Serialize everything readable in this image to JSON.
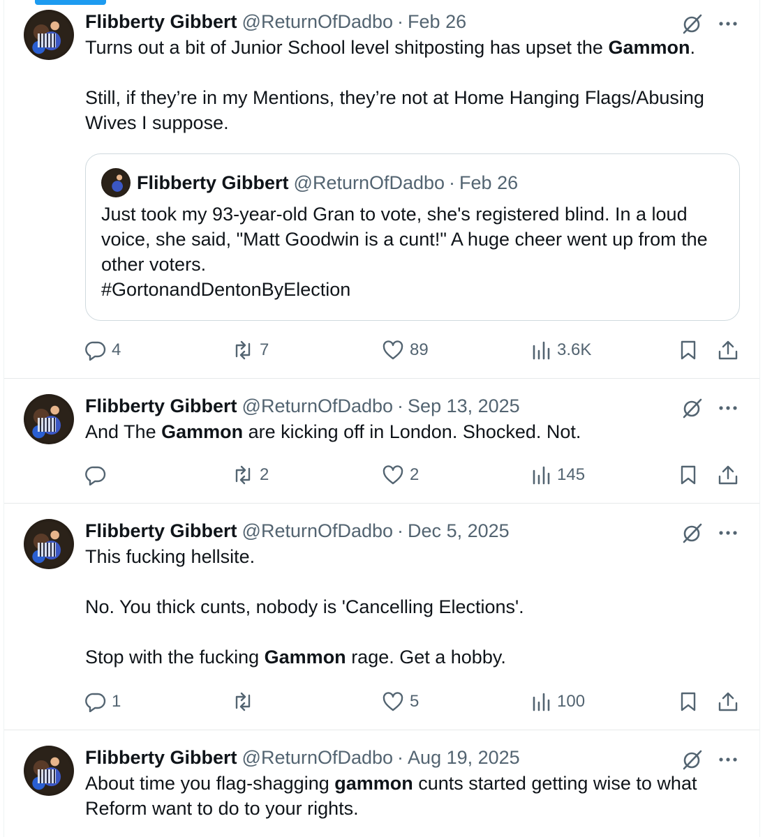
{
  "author": {
    "name": "Flibberty Gibbert",
    "handle": "@ReturnOfDadbo",
    "separator": "·"
  },
  "tweets": [
    {
      "date": "Feb 26",
      "text_parts": [
        {
          "t": "Turns out a bit of Junior School level shitposting has upset the "
        },
        {
          "t": "Gammon",
          "bold": true
        },
        {
          "t": ".\n\nStill, if they’re in my Mentions, they’re not at Home Hanging Flags/Abusing Wives I suppose."
        }
      ],
      "quote": {
        "name": "Flibberty Gibbert",
        "handle": "@ReturnOfDadbo",
        "date": "Feb 26",
        "text": "Just took my 93-year-old Gran to vote, she's registered blind. In a loud voice, she said, \"Matt Goodwin is a cunt!\" A huge cheer went up from the other voters.\n#GortonandDentonByElection"
      },
      "stats": {
        "replies": "4",
        "reposts": "7",
        "likes": "89",
        "views": "3.6K"
      }
    },
    {
      "date": "Sep 13, 2025",
      "text_parts": [
        {
          "t": "And The "
        },
        {
          "t": "Gammon",
          "bold": true
        },
        {
          "t": " are kicking off in London. Shocked. Not."
        }
      ],
      "stats": {
        "replies": "",
        "reposts": "2",
        "likes": "2",
        "views": "145"
      }
    },
    {
      "date": "Dec 5, 2025",
      "text_parts": [
        {
          "t": "This fucking hellsite.\n\nNo. You thick cunts, nobody is 'Cancelling Elections'.\n\nStop with the fucking "
        },
        {
          "t": "Gammon",
          "bold": true
        },
        {
          "t": " rage. Get a hobby."
        }
      ],
      "stats": {
        "replies": "1",
        "reposts": "",
        "likes": "5",
        "views": "100"
      }
    },
    {
      "date": "Aug 19, 2025",
      "text_parts": [
        {
          "t": "About time you flag-shagging "
        },
        {
          "t": "gammon",
          "bold": true
        },
        {
          "t": " cunts started getting wise to what Reform want to do to your rights."
        }
      ]
    }
  ],
  "colors": {
    "accent": "#1d9bf0",
    "muted": "#536471",
    "text": "#0f1419",
    "border": "#cfd9de"
  }
}
